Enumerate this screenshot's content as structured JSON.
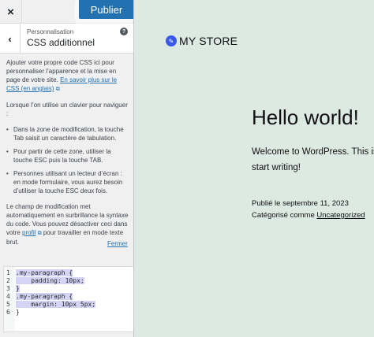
{
  "topbar": {
    "close_label": "×",
    "publish_label": "Publier"
  },
  "section": {
    "back_label": "‹",
    "breadcrumb": "Personnalisation",
    "title": "CSS additionnel",
    "help_label": "?"
  },
  "description": {
    "intro": "Ajouter votre propre code CSS ici pour personnaliser l’apparence et la mise en page de votre site.",
    "intro_link": "En savoir plus sur le CSS (en anglais)",
    "keyboard_intro": "Lorsque l’on utilise un clavier pour naviguer :",
    "bullets": [
      "Dans la zone de modification, la touche Tab saisit un caractère de tabulation.",
      "Pour partir de cette zone, utiliser la touche ESC puis la touche TAB.",
      "Personnes utilisant un lecteur d’écran : en mode formulaire, vous aurez besoin d’utiliser la touche ESC deux fois."
    ],
    "syntax_before": "Le champ de modification met automatiquement en surbrillance la syntaxe du code. Vous pouvez désactiver ceci dans votre",
    "syntax_link": "profil",
    "syntax_after": "pour travailler en mode texte brut.",
    "close_link": "Fermer"
  },
  "editor": {
    "lines": [
      {
        "num": "1",
        "code": ".my-paragraph {"
      },
      {
        "num": "2",
        "code": "    padding: 10px;"
      },
      {
        "num": "3",
        "code": "}"
      },
      {
        "num": "4",
        "code": ".my-paragraph {"
      },
      {
        "num": "5",
        "code": "    margin: 10px 5px;"
      },
      {
        "num": "6",
        "code": "}"
      }
    ]
  },
  "preview": {
    "site_title": "MY STORE",
    "post_title": "Hello world!",
    "welcome_line": "Welcome to WordPress. This is",
    "start_line": "start writing!",
    "published": "Publié le septembre 11, 2023",
    "category_prefix": "Catégorisé comme",
    "category_link": "Uncategorized"
  },
  "colors": {
    "accent": "#2271b1",
    "preview_bg": "#dde9e3",
    "panel_bg": "#f0f0f1",
    "selection": "#d6d4f5"
  }
}
